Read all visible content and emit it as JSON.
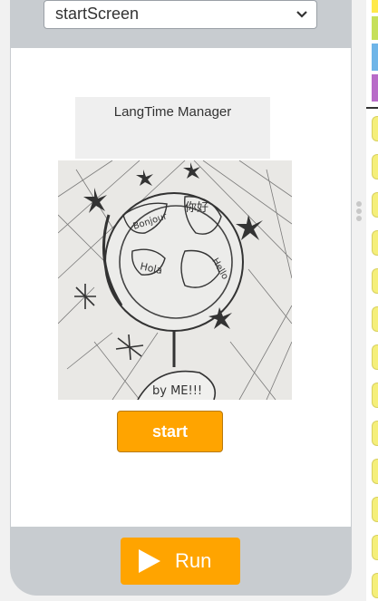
{
  "screen_selector": {
    "value": "startScreen"
  },
  "app": {
    "title": "LangTime Manager",
    "image_alt": "Hand-drawn globe with Bonjour 你好 Hola Hello, by ME!!!",
    "start_label": "start"
  },
  "run_button": {
    "label": "Run"
  },
  "colors": {
    "accent": "#ffa400",
    "device": "#c8ccd0"
  },
  "palette_swatches": [
    "#ffe94a",
    "#c6e05a",
    "#6fb5e8",
    "#b86cc8"
  ]
}
